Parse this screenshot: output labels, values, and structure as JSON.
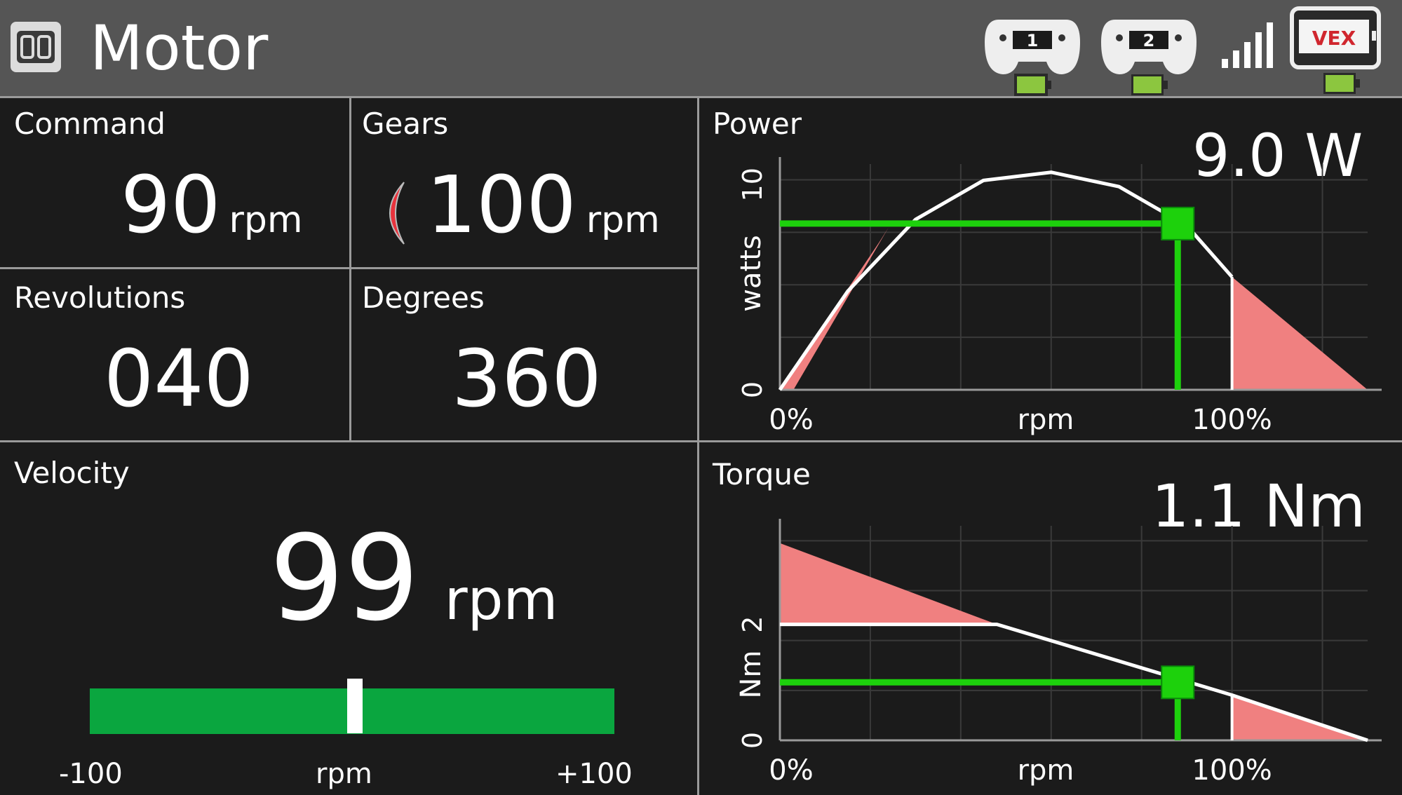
{
  "header": {
    "title": "Motor",
    "port_icon": "port-00-icon",
    "controller_1": {
      "label": "1",
      "icon": "controller-icon",
      "battery": 1.0
    },
    "controller_2": {
      "label": "2",
      "icon": "controller-icon",
      "battery": 1.0
    },
    "signal": {
      "icon": "signal-bars-icon",
      "bars": 5
    },
    "brain": {
      "logo": "VEX",
      "icon": "vex-brain-icon",
      "battery": 1.0
    }
  },
  "command": {
    "label": "Command",
    "value": "90",
    "unit": "rpm"
  },
  "gears": {
    "label": "Gears",
    "value": "100",
    "unit": "rpm",
    "icon": "gear-cartridge-icon",
    "icon_color": "#e8323c"
  },
  "revolutions": {
    "label": "Revolutions",
    "value": "040"
  },
  "degrees": {
    "label": "Degrees",
    "value": "360"
  },
  "velocity": {
    "label": "Velocity",
    "value": "99",
    "unit": "rpm",
    "scale_min": "-100",
    "scale_max": "+100",
    "scale_label": "rpm",
    "bar_fraction": 0.505,
    "bar_color": "#0aa63f"
  },
  "power": {
    "label": "Power",
    "readout": "9.0 W",
    "chart_data": {
      "type": "area",
      "ylabel": "watts",
      "xlabel": "rpm",
      "x_ticks": [
        "0%",
        "100%"
      ],
      "y_ticks": [
        "0",
        "10"
      ],
      "ylim": [
        0,
        11
      ],
      "x_range_percent": [
        0,
        130
      ],
      "curve": {
        "x": [
          0,
          15,
          30,
          45,
          60,
          75,
          90,
          100
        ],
        "y": [
          0,
          4.8,
          8.3,
          10.2,
          10.6,
          9.9,
          8.0,
          5.5
        ]
      },
      "overload_region_x": [
        100,
        130
      ],
      "marker": {
        "x": 88,
        "y": 8.1
      },
      "curve_color": "#ffffff",
      "fill_color": "#f08080",
      "marker_color": "#1dd10c"
    }
  },
  "torque": {
    "label": "Torque",
    "readout": "1.1 Nm",
    "chart_data": {
      "type": "area",
      "ylabel": "Nm",
      "xlabel": "rpm",
      "x_ticks": [
        "0%",
        "100%"
      ],
      "y_ticks": [
        "0",
        "2"
      ],
      "ylim": [
        0,
        3.7
      ],
      "x_range_percent": [
        0,
        130
      ],
      "curve": {
        "x": [
          0,
          48,
          100,
          130
        ],
        "y": [
          2.0,
          2.0,
          0.78,
          0
        ]
      },
      "overload_top": {
        "x": [
          0,
          48
        ],
        "y": [
          3.4,
          2.0
        ]
      },
      "marker": {
        "x": 88,
        "y": 1.0
      },
      "curve_color": "#ffffff",
      "fill_color": "#f08080",
      "marker_color": "#1dd10c"
    }
  }
}
